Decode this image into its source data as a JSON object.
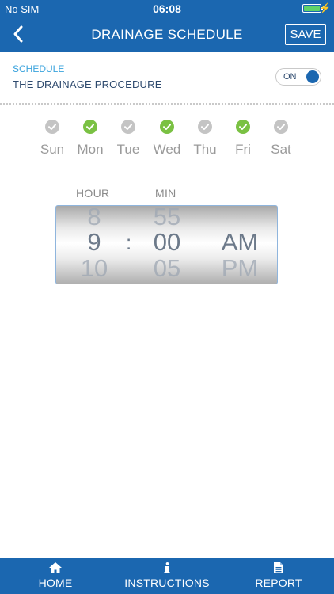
{
  "status_bar": {
    "carrier": "No SIM",
    "time": "06:08"
  },
  "nav": {
    "title": "DRAINAGE SCHEDULE",
    "save_label": "SAVE"
  },
  "schedule": {
    "section_label": "SCHEDULE",
    "procedure_label": "THE DRAINAGE PROCEDURE",
    "toggle_label": "ON"
  },
  "days": [
    {
      "label": "Sun",
      "checked": false
    },
    {
      "label": "Mon",
      "checked": true
    },
    {
      "label": "Tue",
      "checked": false
    },
    {
      "label": "Wed",
      "checked": true
    },
    {
      "label": "Thu",
      "checked": false
    },
    {
      "label": "Fri",
      "checked": true
    },
    {
      "label": "Sat",
      "checked": false
    }
  ],
  "time_picker": {
    "hour_header": "HOUR",
    "min_header": "MIN",
    "separator": ":",
    "hour_prev": "8",
    "hour": "9",
    "hour_next": "10",
    "min_prev": "55",
    "min": "00",
    "min_next": "05",
    "period": "AM",
    "period_next": "PM"
  },
  "colors": {
    "brand": "#1b67b0",
    "checked": "#7ac143",
    "unchecked": "#c4c4c4",
    "accent": "#3aa3dd"
  },
  "tabs": [
    {
      "label": "HOME",
      "icon": "home-icon"
    },
    {
      "label": "INSTRUCTIONS",
      "icon": "info-icon"
    },
    {
      "label": "REPORT",
      "icon": "document-icon"
    }
  ]
}
